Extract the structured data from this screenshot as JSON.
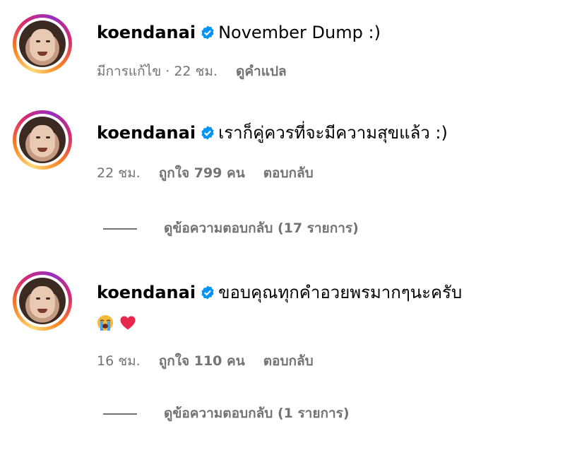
{
  "comments": [
    {
      "username": "koendanai",
      "text": "November Dump :)",
      "meta_text": "มีการแก้ไข · 22 ชม.",
      "action": "ดูคำแปล"
    },
    {
      "username": "koendanai",
      "text": "เราก็คู่ควรที่จะมีความสุขแล้ว :)",
      "time": "22 ชม.",
      "likes": "ถูกใจ 799 คน",
      "reply": "ตอบกลับ",
      "view_replies": "ดูข้อความตอบกลับ (17 รายการ)"
    },
    {
      "username": "koendanai",
      "text": "ขอบคุณทุกคำอวยพรมากๆนะครับ",
      "emojis": [
        "loudly-crying-face-icon",
        "red-heart-icon"
      ],
      "time": "16 ชม.",
      "likes": "ถูกใจ 110 คน",
      "reply": "ตอบกลับ",
      "view_replies": "ดูข้อความตอบกลับ (1 รายการ)"
    }
  ],
  "colors": {
    "verified": "#0095f6",
    "meta": "#737373"
  }
}
